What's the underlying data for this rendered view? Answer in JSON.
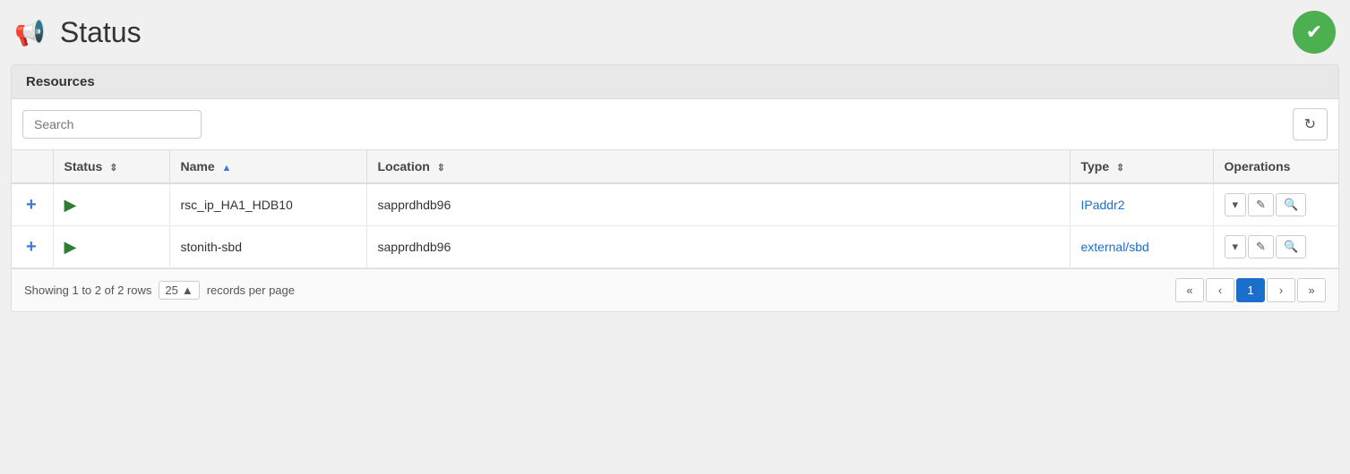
{
  "header": {
    "title": "Status",
    "megaphone": "📢",
    "status_ok_icon": "✔"
  },
  "card": {
    "section_title": "Resources"
  },
  "toolbar": {
    "search_placeholder": "Search",
    "refresh_icon": "↻"
  },
  "table": {
    "columns": [
      {
        "id": "check",
        "label": ""
      },
      {
        "id": "status",
        "label": "Status",
        "sort": "both"
      },
      {
        "id": "name",
        "label": "Name",
        "sort": "up"
      },
      {
        "id": "location",
        "label": "Location",
        "sort": "both"
      },
      {
        "id": "type",
        "label": "Type",
        "sort": "both"
      },
      {
        "id": "operations",
        "label": "Operations"
      }
    ],
    "rows": [
      {
        "id": "row-1",
        "plus": "+",
        "status_icon": "▶",
        "name": "rsc_ip_HA1_HDB10",
        "location": "sapprdhdb96",
        "type": "IPaddr2",
        "type_link": true,
        "ops": [
          "▾",
          "✎",
          "🔍"
        ]
      },
      {
        "id": "row-2",
        "plus": "+",
        "status_icon": "▶",
        "name": "stonith-sbd",
        "location": "sapprdhdb96",
        "type": "external/sbd",
        "type_link": true,
        "ops": [
          "▾",
          "✎",
          "🔍"
        ]
      }
    ]
  },
  "footer": {
    "showing_text": "Showing 1 to 2 of 2 rows",
    "per_page_value": "25",
    "per_page_arrow": "▲",
    "records_text": "records per page",
    "pagination": {
      "first": "«",
      "prev": "‹",
      "current": "1",
      "next": "›",
      "last": "»"
    }
  }
}
